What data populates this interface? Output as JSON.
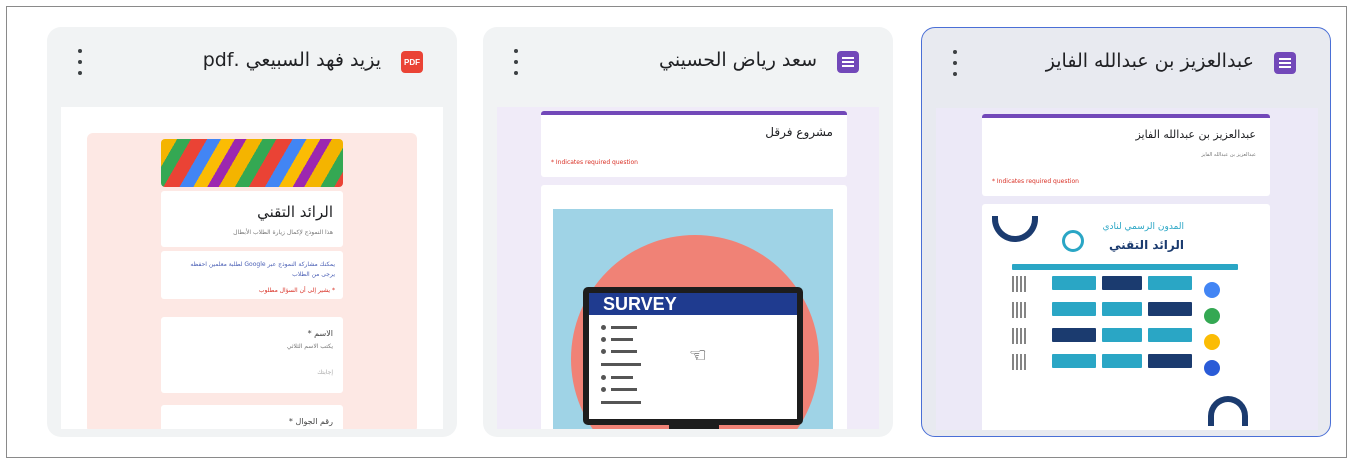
{
  "cards": [
    {
      "title": "يزيد فهد السبيعي .pdf",
      "icon_type": "pdf-icon",
      "icon_label": "PDF",
      "menu": "more-options",
      "preview": {
        "heading": "الرائد التقني",
        "subtitle": "هذا النموذج لإكمال زيارة الطلاب الأبطال",
        "note": "يمكنك مشاركة النموذج عبر Google لطلبة معلمين احفظه",
        "note2": "يرجى من الطلاب",
        "required": "* يشير إلى أن السؤال مطلوب",
        "q1_label": "الاسم *",
        "q1_hint": "يكتب الاسم الثلاثي",
        "q1_answer": "إجابتك",
        "q2_label": "رقم الجوال *"
      }
    },
    {
      "title": "سعد رياض الحسيني",
      "icon_type": "forms-icon",
      "menu": "more-options",
      "preview": {
        "heading": "مشروع فرقل",
        "required": "* Indicates required question",
        "image_word": "SURVEY"
      }
    },
    {
      "title": "عبدالعزيز بن عبدالله الفايز",
      "icon_type": "forms-icon",
      "menu": "more-options",
      "selected": true,
      "preview": {
        "heading": "عبدالعزيز بن عبدالله الفايز",
        "subheading": "عبدالعزيز بن عبدالله الفايز",
        "required": "* Indicates required question",
        "poster_title": "المدون الرسمي لنادي",
        "poster_brand": "الرائد التقني"
      }
    }
  ],
  "colors": {
    "forms_purple": "#7248b9",
    "pdf_red": "#ea4335",
    "selected_border": "#4a6fd6",
    "card_bg": "#f1f3f4"
  }
}
